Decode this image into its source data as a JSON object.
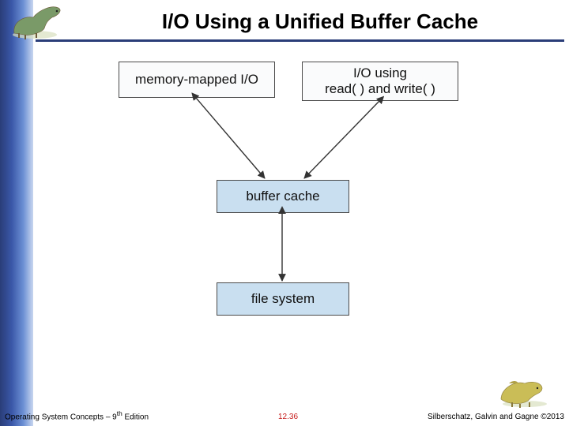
{
  "title": "I/O Using a Unified Buffer Cache",
  "boxes": {
    "mmap": {
      "line1": "memory-mapped I/O"
    },
    "rw": {
      "line1": "I/O using",
      "line2": "read( ) and write( )"
    },
    "buf": {
      "line1": "buffer cache"
    },
    "fs": {
      "line1": "file system"
    }
  },
  "footer": {
    "left_a": "Operating System Concepts – 9",
    "left_sup": "th",
    "left_b": " Edition",
    "center": "12.36",
    "right": "Silberschatz, Galvin and Gagne ©2013"
  },
  "icons": {
    "dino_tl": "dino-icon",
    "dino_br": "dino-icon"
  },
  "chart_data": {
    "type": "diagram",
    "title": "I/O Using a Unified Buffer Cache",
    "nodes": [
      {
        "id": "mmap",
        "label": "memory-mapped I/O"
      },
      {
        "id": "rw",
        "label": "I/O using read( ) and write( )"
      },
      {
        "id": "buf",
        "label": "buffer cache"
      },
      {
        "id": "fs",
        "label": "file system"
      }
    ],
    "edges": [
      {
        "from": "mmap",
        "to": "buf",
        "bidirectional": true
      },
      {
        "from": "rw",
        "to": "buf",
        "bidirectional": true
      },
      {
        "from": "buf",
        "to": "fs",
        "bidirectional": true
      }
    ]
  }
}
